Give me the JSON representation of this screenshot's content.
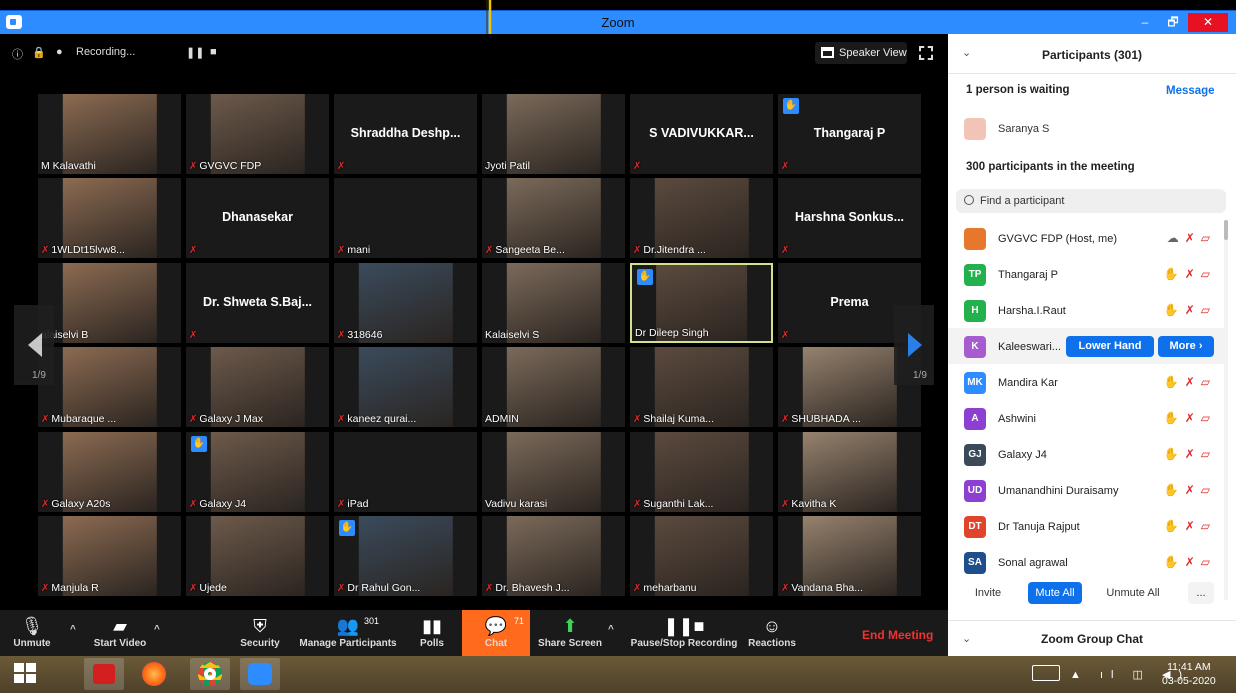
{
  "window": {
    "title": "Zoom",
    "min": "–",
    "max": "🗗",
    "close": "✕"
  },
  "topbar": {
    "recording": "Recording...",
    "speaker_view": "Speaker View"
  },
  "grid": {
    "page_left": "1/9",
    "page_right": "1/9",
    "tiles": [
      {
        "name": "M Kalavathi",
        "big": "",
        "video": true,
        "mic": false,
        "hand": false
      },
      {
        "name": "GVGVC FDP",
        "big": "",
        "video": true,
        "mic": true,
        "hand": false
      },
      {
        "name": "",
        "big": "Shraddha  Deshp...",
        "video": false,
        "mic": true,
        "hand": false
      },
      {
        "name": "Jyoti Patil",
        "big": "",
        "video": true,
        "mic": false,
        "hand": false
      },
      {
        "name": "",
        "big": "S  VADIVUKKAR...",
        "video": false,
        "mic": true,
        "hand": false
      },
      {
        "name": "",
        "big": "Thangaraj  P",
        "video": false,
        "mic": true,
        "hand": true
      },
      {
        "name": "1WLDt15lvw8...",
        "big": "",
        "video": true,
        "mic": true,
        "hand": false
      },
      {
        "name": "",
        "big": "Dhanasekar",
        "video": false,
        "mic": true,
        "hand": false
      },
      {
        "name": "mani",
        "big": "",
        "video": false,
        "mic": true,
        "hand": false
      },
      {
        "name": "Sangeeta Be...",
        "big": "",
        "video": true,
        "mic": true,
        "hand": false
      },
      {
        "name": "Dr.Jitendra ...",
        "big": "",
        "video": true,
        "mic": true,
        "hand": false
      },
      {
        "name": "",
        "big": "Harshna  Sonkus...",
        "video": false,
        "mic": true,
        "hand": false
      },
      {
        "name": "alaiselvi B",
        "big": "",
        "video": true,
        "mic": false,
        "hand": false
      },
      {
        "name": "",
        "big": "Dr.  Shweta  S.Baj...",
        "video": false,
        "mic": true,
        "hand": false
      },
      {
        "name": "318646",
        "big": "",
        "video": true,
        "mic": true,
        "hand": false
      },
      {
        "name": "Kalaiselvi S",
        "big": "",
        "video": true,
        "mic": false,
        "hand": false
      },
      {
        "name": "Dr Dileep Singh",
        "big": "",
        "video": true,
        "mic": false,
        "hand": true,
        "active": true
      },
      {
        "name": "",
        "big": "Prema",
        "video": false,
        "mic": true,
        "hand": false
      },
      {
        "name": "Mubaraque ...",
        "big": "",
        "video": true,
        "mic": true,
        "hand": false
      },
      {
        "name": "Galaxy J Max",
        "big": "",
        "video": true,
        "mic": true,
        "hand": false
      },
      {
        "name": "kaneez qurai...",
        "big": "",
        "video": true,
        "mic": true,
        "hand": false
      },
      {
        "name": "ADMIN",
        "big": "",
        "video": true,
        "mic": false,
        "hand": false
      },
      {
        "name": "Shailaj Kuma...",
        "big": "",
        "video": true,
        "mic": true,
        "hand": false
      },
      {
        "name": "SHUBHADA ...",
        "big": "",
        "video": true,
        "mic": true,
        "hand": false
      },
      {
        "name": "Galaxy A20s",
        "big": "",
        "video": true,
        "mic": true,
        "hand": false
      },
      {
        "name": "Galaxy J4",
        "big": "",
        "video": true,
        "mic": true,
        "hand": true
      },
      {
        "name": "iPad",
        "big": "",
        "video": false,
        "mic": true,
        "hand": false
      },
      {
        "name": "Vadivu karasi",
        "big": "",
        "video": true,
        "mic": false,
        "hand": false
      },
      {
        "name": "Suganthi Lak...",
        "big": "",
        "video": true,
        "mic": true,
        "hand": false
      },
      {
        "name": "Kavitha K",
        "big": "",
        "video": true,
        "mic": true,
        "hand": false
      },
      {
        "name": "Manjula R",
        "big": "",
        "video": true,
        "mic": true,
        "hand": false
      },
      {
        "name": "Ujede",
        "big": "",
        "video": true,
        "mic": true,
        "hand": false
      },
      {
        "name": "Dr Rahul Gon...",
        "big": "",
        "video": true,
        "mic": true,
        "hand": true
      },
      {
        "name": "Dr. Bhavesh J...",
        "big": "",
        "video": true,
        "mic": true,
        "hand": false
      },
      {
        "name": "meharbanu",
        "big": "",
        "video": true,
        "mic": true,
        "hand": false
      },
      {
        "name": "Vandana Bha...",
        "big": "",
        "video": true,
        "mic": true,
        "hand": false
      }
    ]
  },
  "toolbar": {
    "unmute": "Unmute",
    "start_video": "Start Video",
    "security": "Security",
    "manage_participants": "Manage Participants",
    "participants_count": "301",
    "polls": "Polls",
    "chat": "Chat",
    "chat_count": "71",
    "share_screen": "Share Screen",
    "recording": "Pause/Stop Recording",
    "reactions": "Reactions",
    "end_meeting": "End Meeting"
  },
  "panel": {
    "title": "Participants (301)",
    "waiting": "1 person is waiting",
    "message": "Message",
    "waiting_name": "Saranya S",
    "in_meeting": "300 participants in the meeting",
    "search_placeholder": "Find a participant",
    "participants": [
      {
        "initials": "",
        "name": "GVGVC FDP (Host, me)",
        "color": "#e8772e"
      },
      {
        "initials": "TP",
        "name": "Thangaraj P",
        "color": "#23b14d"
      },
      {
        "initials": "H",
        "name": "Harsha.I.Raut",
        "color": "#23b14d"
      },
      {
        "initials": "K",
        "name": "Kaleeswari...",
        "color": "#a65ccf"
      },
      {
        "initials": "MK",
        "name": "Mandira Kar",
        "color": "#2d8cff"
      },
      {
        "initials": "A",
        "name": "Ashwini",
        "color": "#8c3fd1"
      },
      {
        "initials": "GJ",
        "name": "Galaxy J4",
        "color": "#3a4a5a"
      },
      {
        "initials": "UD",
        "name": "Umanandhini Duraisamy",
        "color": "#8c3fd1"
      },
      {
        "initials": "DT",
        "name": "Dr Tanuja Rajput",
        "color": "#e0452b"
      },
      {
        "initials": "SA",
        "name": "Sonal agrawal",
        "color": "#1e4e8c"
      }
    ],
    "lower_hand": "Lower Hand",
    "more": "More ›",
    "invite": "Invite",
    "mute_all": "Mute All",
    "unmute_all": "Unmute All",
    "ellipsis": "...",
    "chat_title": "Zoom Group Chat"
  },
  "taskbar": {
    "time": "11:41 AM",
    "date": "03-05-2020"
  }
}
